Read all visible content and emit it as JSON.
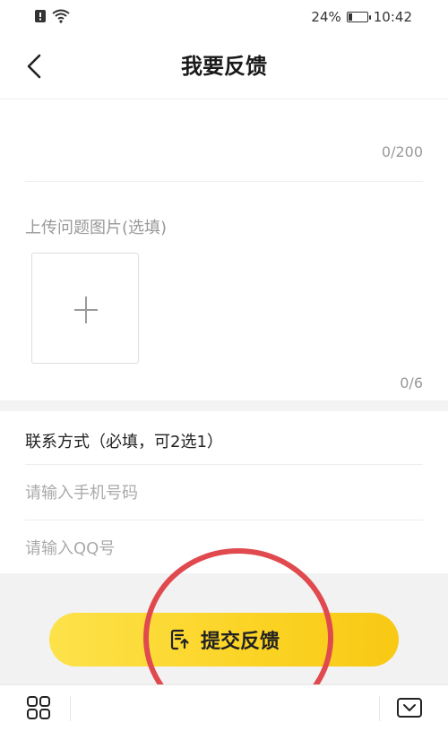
{
  "status_bar": {
    "battery_percent_text": "24%",
    "battery_level": 0.24,
    "time": "10:42"
  },
  "header": {
    "title": "我要反馈"
  },
  "feedback": {
    "char_count": "0/200"
  },
  "upload": {
    "label": "上传问题图片(选填)",
    "image_count": "0/6"
  },
  "contact": {
    "title": "联系方式（必填，可2选1）",
    "phone_placeholder": "请输入手机号码",
    "qq_placeholder": "请输入QQ号"
  },
  "submit": {
    "label": "提交反馈"
  },
  "colors": {
    "accent_yellow": "#fbd324",
    "annotation_red": "#e04a4f"
  },
  "icons": {
    "back": "chevron-left-icon",
    "plus": "plus-icon",
    "submit": "upload-document-icon",
    "nav_left": "grid-apps-icon",
    "nav_right": "collapse-down-icon"
  }
}
